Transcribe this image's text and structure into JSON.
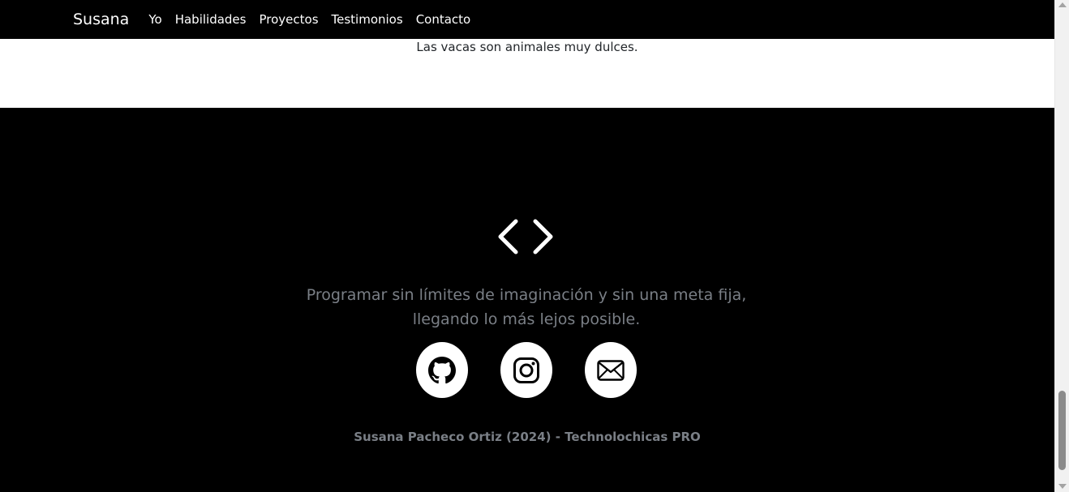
{
  "navbar": {
    "brand": "Susana",
    "links": [
      {
        "label": "Yo"
      },
      {
        "label": "Habilidades"
      },
      {
        "label": "Proyectos"
      },
      {
        "label": "Testimonios"
      },
      {
        "label": "Contacto"
      }
    ]
  },
  "testimonial": {
    "text": "Las vacas son animales muy dulces."
  },
  "footer": {
    "icon": "code-icon",
    "tagline": "Programar sin límites de imaginación y sin una meta fija, llegando lo más lejos posible.",
    "socials": [
      {
        "icon": "github-icon"
      },
      {
        "icon": "instagram-icon"
      },
      {
        "icon": "envelope-icon"
      }
    ],
    "copyright": "Susana Pacheco Ortiz (2024) - Technolochicas PRO"
  },
  "colors": {
    "navbar_bg": "#000000",
    "footer_bg": "#000000",
    "muted_text": "#7a7f86"
  }
}
